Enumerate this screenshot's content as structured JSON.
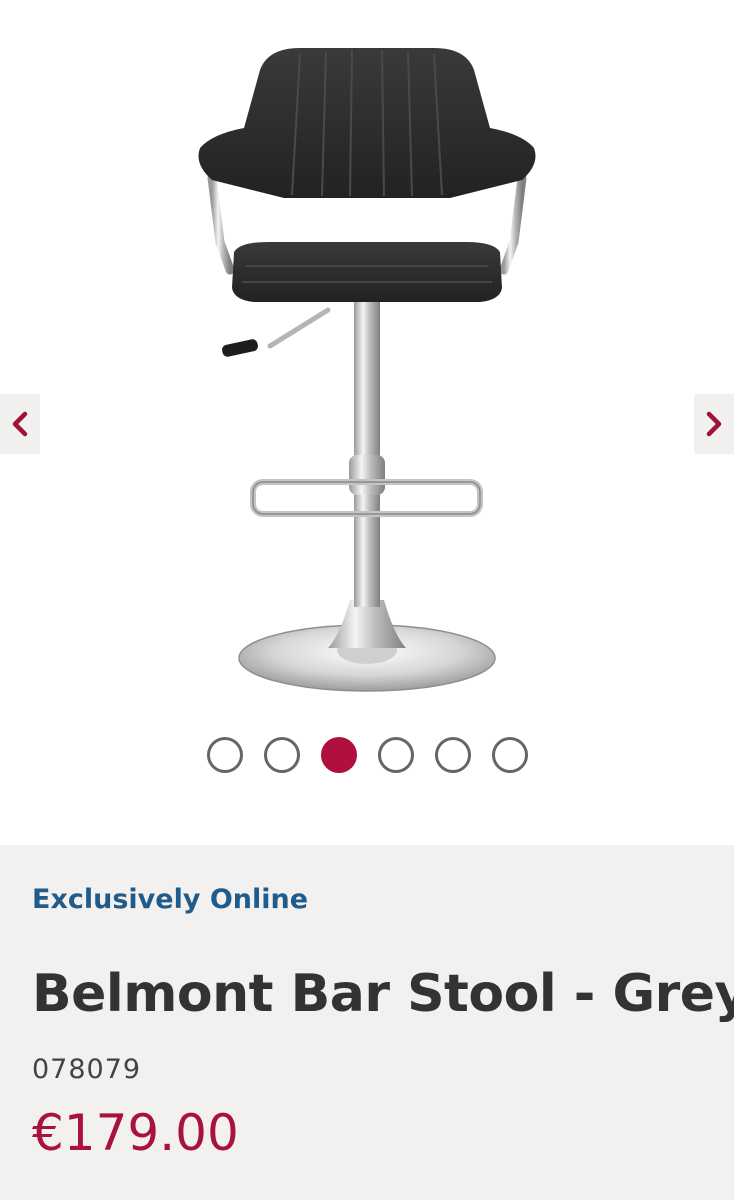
{
  "gallery": {
    "image_alt": "Belmont Bar Stool - Grey",
    "prev_icon": "chevron-left-icon",
    "next_icon": "chevron-right-icon",
    "dot_count": 6,
    "active_dot_index": 2,
    "accent_color": "#b0103e"
  },
  "product": {
    "badge": "Exclusively Online",
    "title": "Belmont Bar Stool - Grey",
    "sku": "078079",
    "price": "€179.00"
  },
  "colors": {
    "badge": "#1f5c8b",
    "price": "#a8123f",
    "info_background": "#f2f1f0"
  }
}
